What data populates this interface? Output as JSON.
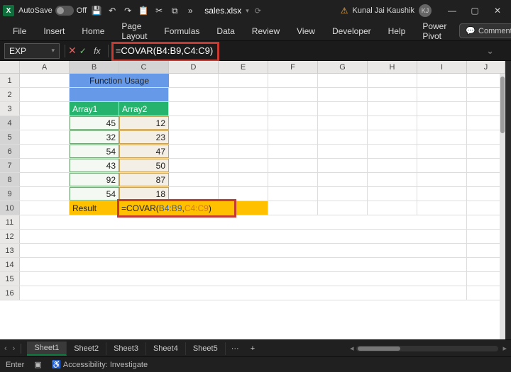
{
  "titlebar": {
    "autosave_label": "AutoSave",
    "autosave_state": "Off",
    "filename": "sales.xlsx",
    "user_name": "Kunal Jai Kaushik",
    "user_initials": "KJ"
  },
  "ribbon": {
    "tabs": [
      {
        "label": "File"
      },
      {
        "label": "Insert"
      },
      {
        "label": "Home"
      },
      {
        "label": "Page Layout"
      },
      {
        "label": "Formulas"
      },
      {
        "label": "Data"
      },
      {
        "label": "Review"
      },
      {
        "label": "View"
      },
      {
        "label": "Developer"
      },
      {
        "label": "Help"
      },
      {
        "label": "Power Pivot"
      }
    ],
    "comments_label": "Comments"
  },
  "formula": {
    "name_box": "EXP",
    "fx_label": "fx",
    "bar_text": "=COVAR(B4:B9,C4:C9)",
    "bar_blue": "B4:B9",
    "bar_orange": "C4:C9"
  },
  "grid": {
    "columns": [
      "A",
      "B",
      "C",
      "D",
      "E",
      "F",
      "G",
      "H",
      "I",
      "J"
    ],
    "rows_visible": 16,
    "header_merged": "Function Usage",
    "b3": "Array1",
    "c3": "Array2",
    "data_b": [
      45,
      32,
      54,
      43,
      92,
      54
    ],
    "data_c": [
      12,
      23,
      47,
      50,
      87,
      18
    ],
    "b10": "Result",
    "c10_prefix": "=COVAR(",
    "c10_blue": "B4:B9",
    "c10_comma": ",",
    "c10_orange": "C4:C9",
    "c10_suffix": ")"
  },
  "sheets": {
    "tabs": [
      {
        "label": "Sheet1"
      },
      {
        "label": "Sheet2"
      },
      {
        "label": "Sheet3"
      },
      {
        "label": "Sheet4"
      },
      {
        "label": "Sheet5"
      }
    ],
    "more": "···",
    "add": "+"
  },
  "status": {
    "mode": "Enter",
    "accessibility": "Accessibility: Investigate"
  }
}
